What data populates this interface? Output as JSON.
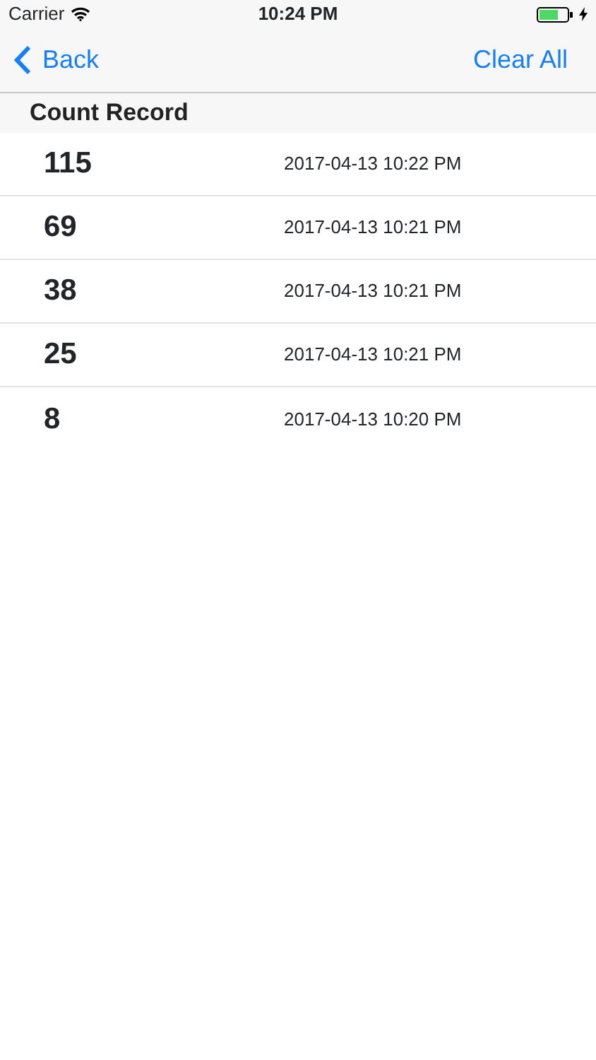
{
  "status_bar": {
    "carrier": "Carrier",
    "time": "10:24 PM"
  },
  "nav_bar": {
    "back": "Back",
    "action": "Clear All"
  },
  "section": {
    "title": "Count Record"
  },
  "records": [
    {
      "count": "115",
      "time": "2017-04-13 10:22 PM"
    },
    {
      "count": "69",
      "time": "2017-04-13 10:21 PM"
    },
    {
      "count": "38",
      "time": "2017-04-13 10:21 PM"
    },
    {
      "count": "25",
      "time": "2017-04-13 10:21 PM"
    },
    {
      "count": "8",
      "time": "2017-04-13 10:20 PM"
    }
  ]
}
